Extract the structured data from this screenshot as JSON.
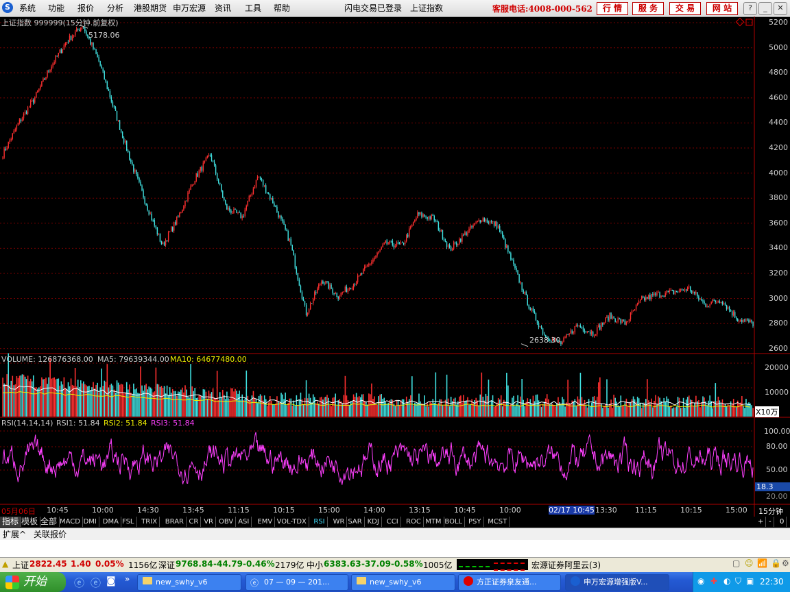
{
  "menu": {
    "items": [
      "系统",
      "功能",
      "报价",
      "分析",
      "港股期货",
      "申万宏源",
      "资讯",
      "工具",
      "帮助"
    ],
    "login_status": "闪电交易已登录",
    "current_index": "上证指数",
    "hotline": "客服电话:4008-000-562",
    "right_buttons": [
      "行 情",
      "服 务",
      "交 易",
      "网 站"
    ]
  },
  "chart_header": {
    "title": "上证指数 999999(15分钟.前复权)",
    "high_label": "5178.06",
    "low_label": "2638.30"
  },
  "volume": {
    "label": "VOLUME: 126876368.00",
    "ma5": "MA5: 79639344.00",
    "ma10": "MA10: 64677480.00",
    "unit": "X10万",
    "ticks": [
      "20000",
      "10000"
    ]
  },
  "rsi": {
    "label": "RSI(14,14,14)",
    "rsi1": "RSI1: 51.84",
    "rsi2": "RSI2: 51.84",
    "rsi3": "RSI3: 51.84",
    "current": "18.3",
    "ticks": [
      "100.00",
      "80.00",
      "50.00",
      "20.00"
    ]
  },
  "chart_data": {
    "type": "candlestick",
    "y_ticks": [
      5200,
      5000,
      4800,
      4600,
      4400,
      4200,
      4000,
      3800,
      3600,
      3400,
      3200,
      3000,
      2800,
      2600
    ],
    "ylim": [
      2560,
      5250
    ],
    "high": 5178.06,
    "low": 2638.3,
    "keypoints": [
      4150,
      4400,
      4600,
      4850,
      5050,
      5178,
      4900,
      4500,
      4100,
      3750,
      3420,
      3650,
      3950,
      4150,
      3720,
      3650,
      3980,
      3750,
      3450,
      2880,
      3150,
      3020,
      3120,
      3280,
      3440,
      3420,
      3670,
      3640,
      3390,
      3520,
      3640,
      3580,
      3260,
      2930,
      2700,
      2640,
      2790,
      2720,
      2860,
      2800,
      2990,
      3030,
      3050,
      3080,
      2950,
      2990,
      2840,
      2800
    ]
  },
  "x_axis": {
    "labels": [
      "05月06日",
      "10:45",
      "10:00",
      "14:30",
      "13:45",
      "11:15",
      "10:15",
      "15:00",
      "14:00",
      "13:15",
      "10:45",
      "10:00",
      "02/17 10:45",
      "13:30",
      "11:15",
      "10:15",
      "15:00"
    ],
    "period": "15分钟"
  },
  "indicator_tabs": [
    "指标",
    "模板",
    "全部",
    "MACD",
    "DMI",
    "DMA",
    "FSL",
    "TRIX",
    "BRAR",
    "CR",
    "VR",
    "OBV",
    "ASI",
    "EMV",
    "VOL-TDX",
    "RSI",
    "WR",
    "SAR",
    "KDJ",
    "CCI",
    "ROC",
    "MTM",
    "BOLL",
    "PSY",
    "MCST"
  ],
  "bottom_tabs": [
    "扩展^",
    "关联报价"
  ],
  "status_bar": {
    "sh_name": "上证",
    "sh_value": "2822.45",
    "sh_change": "1.40",
    "sh_pct": "0.05%",
    "sh_amount": "1156亿",
    "sz_name": "深证",
    "sz_value": "9768.84",
    "sz_change": "-44.79",
    "sz_pct": "-0.46%",
    "sz_amount": "2179亿",
    "zx_name": "中小",
    "zx_value": "6383.63",
    "zx_change": "-37.09",
    "zx_pct": "-0.58%",
    "zx_amount": "1005亿",
    "broker": "宏源证券阿里云(3)"
  },
  "taskbar": {
    "start": "开始",
    "tasks": [
      "new_swhy_v6",
      "07 — 09 — 201...",
      "new_swhy_v6",
      "方正证券泉友通...",
      "申万宏源增强版V..."
    ],
    "clock": "22:30"
  }
}
